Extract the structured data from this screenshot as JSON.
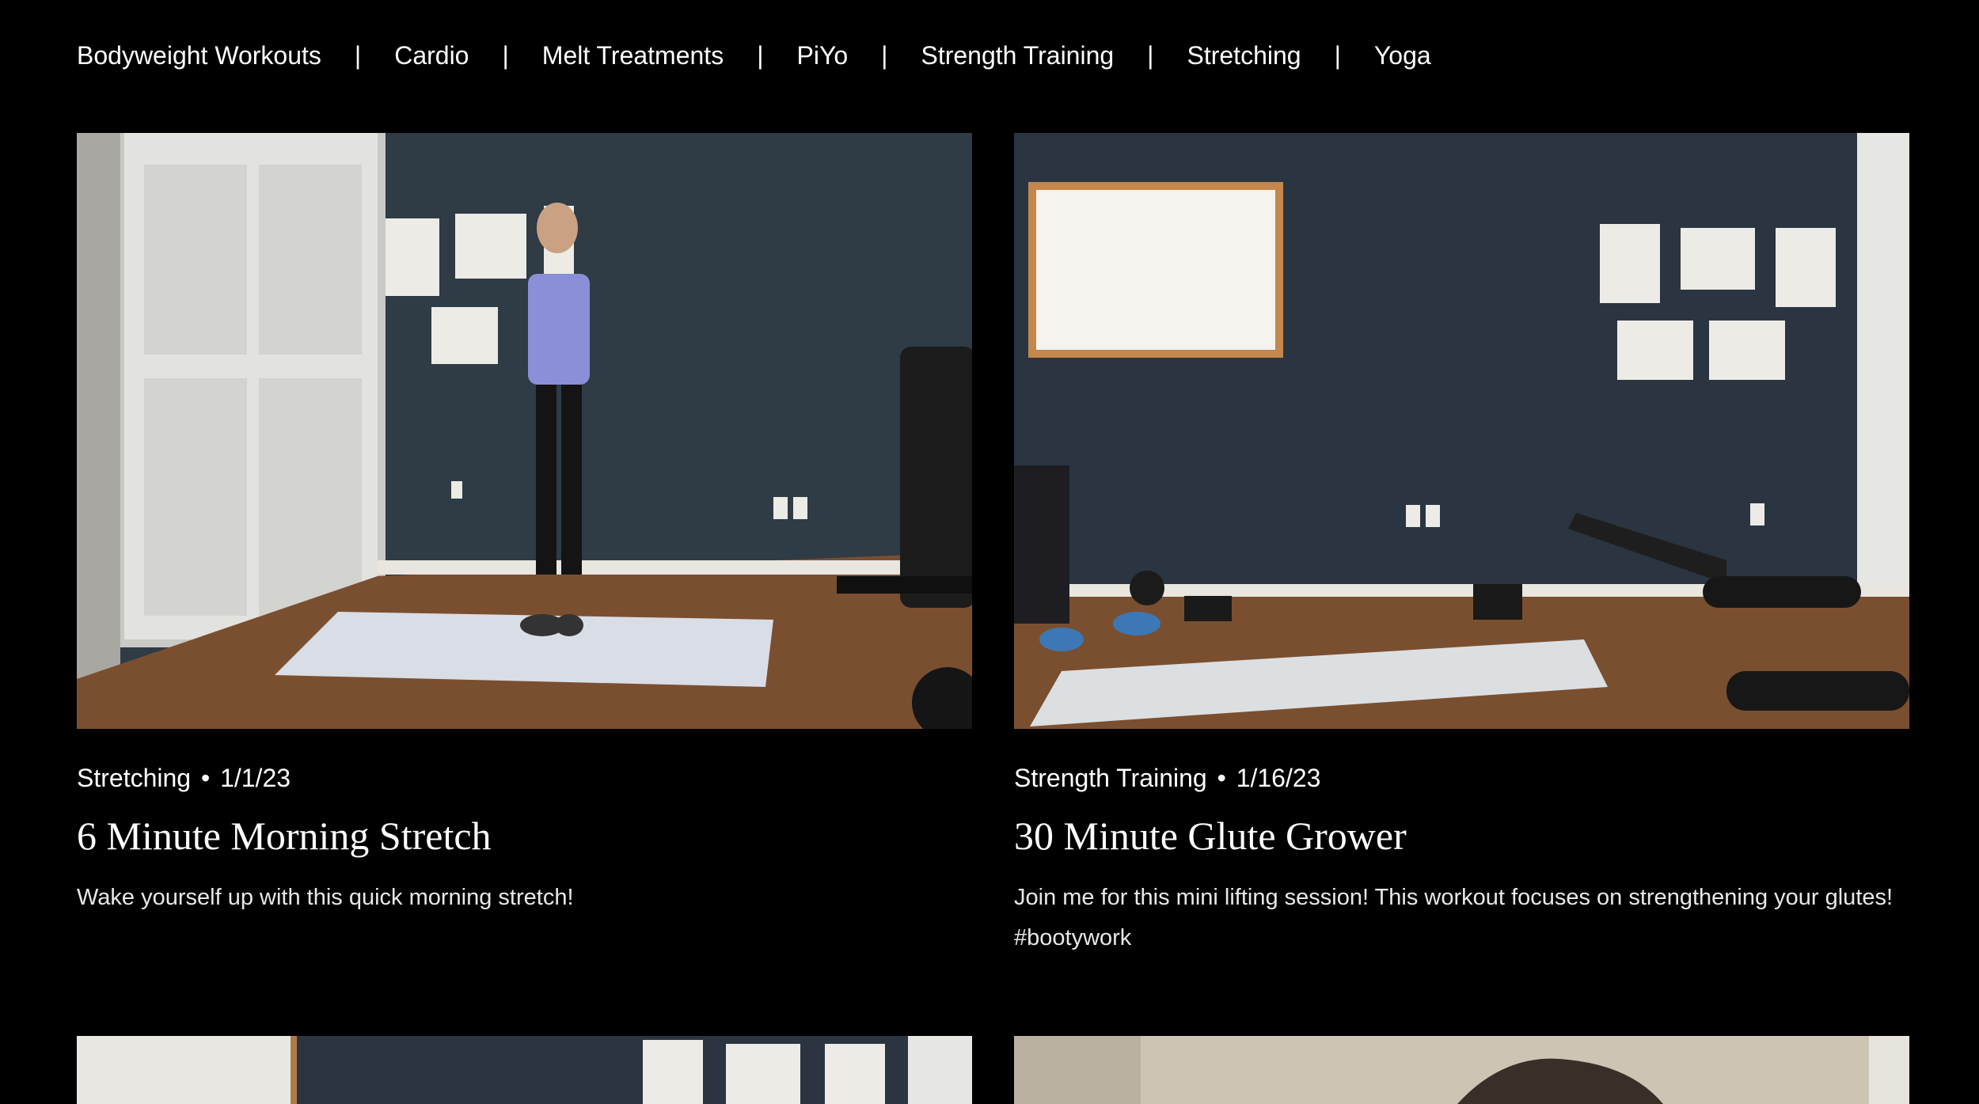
{
  "nav": {
    "categories": [
      {
        "label": "Bodyweight Workouts"
      },
      {
        "label": "Cardio"
      },
      {
        "label": "Melt Treatments"
      },
      {
        "label": "PiYo"
      },
      {
        "label": "Strength Training"
      },
      {
        "label": "Stretching"
      },
      {
        "label": "Yoga"
      }
    ],
    "separator": "|"
  },
  "posts": [
    {
      "category": "Stretching",
      "separator": "•",
      "date": "1/1/23",
      "title": "6 Minute Morning Stretch",
      "excerpt": "Wake yourself up with this quick morning stretch!"
    },
    {
      "category": "Strength Training",
      "separator": "•",
      "date": "1/16/23",
      "title": "30 Minute Glute Grower",
      "excerpt": "Join me for this mini lifting session! This workout focuses on strengthening your glutes! #bootywork"
    }
  ],
  "colors": {
    "background": "#000000",
    "text": "#ffffff",
    "wall": "#2f3b45",
    "floor": "#7a4f30",
    "mat": "#d9dde6"
  }
}
